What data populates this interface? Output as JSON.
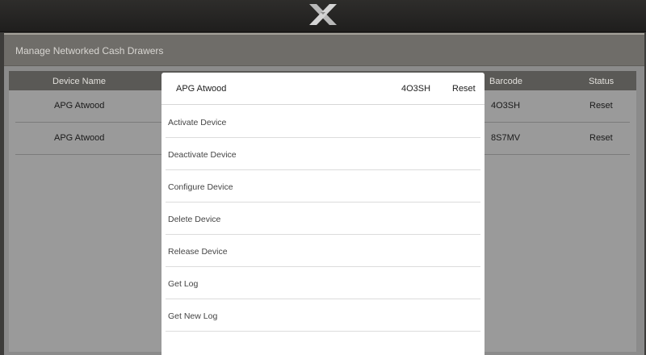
{
  "panel": {
    "title": "Manage Networked Cash Drawers"
  },
  "table": {
    "columns": [
      "Device Name",
      "Barcode",
      "Status"
    ],
    "rows": [
      {
        "device_name": "APG Atwood",
        "barcode": "4O3SH",
        "status": "Reset"
      },
      {
        "device_name": "APG Atwood",
        "barcode": "8S7MV",
        "status": "Reset"
      }
    ]
  },
  "popup": {
    "device_name": "APG Atwood",
    "barcode": "4O3SH",
    "status": "Reset",
    "menu": [
      {
        "label": "Activate Device"
      },
      {
        "label": "Deactivate Device"
      },
      {
        "label": "Configure Device"
      },
      {
        "label": "Delete Device"
      },
      {
        "label": "Release Device"
      },
      {
        "label": "Get Log"
      },
      {
        "label": "Get New Log"
      }
    ]
  },
  "colors": {
    "popup_bg": "#ffffff",
    "panel_header": "#6f6d69",
    "table_header": "#5a5956"
  },
  "icons": {
    "logo": "x-logo-icon"
  }
}
